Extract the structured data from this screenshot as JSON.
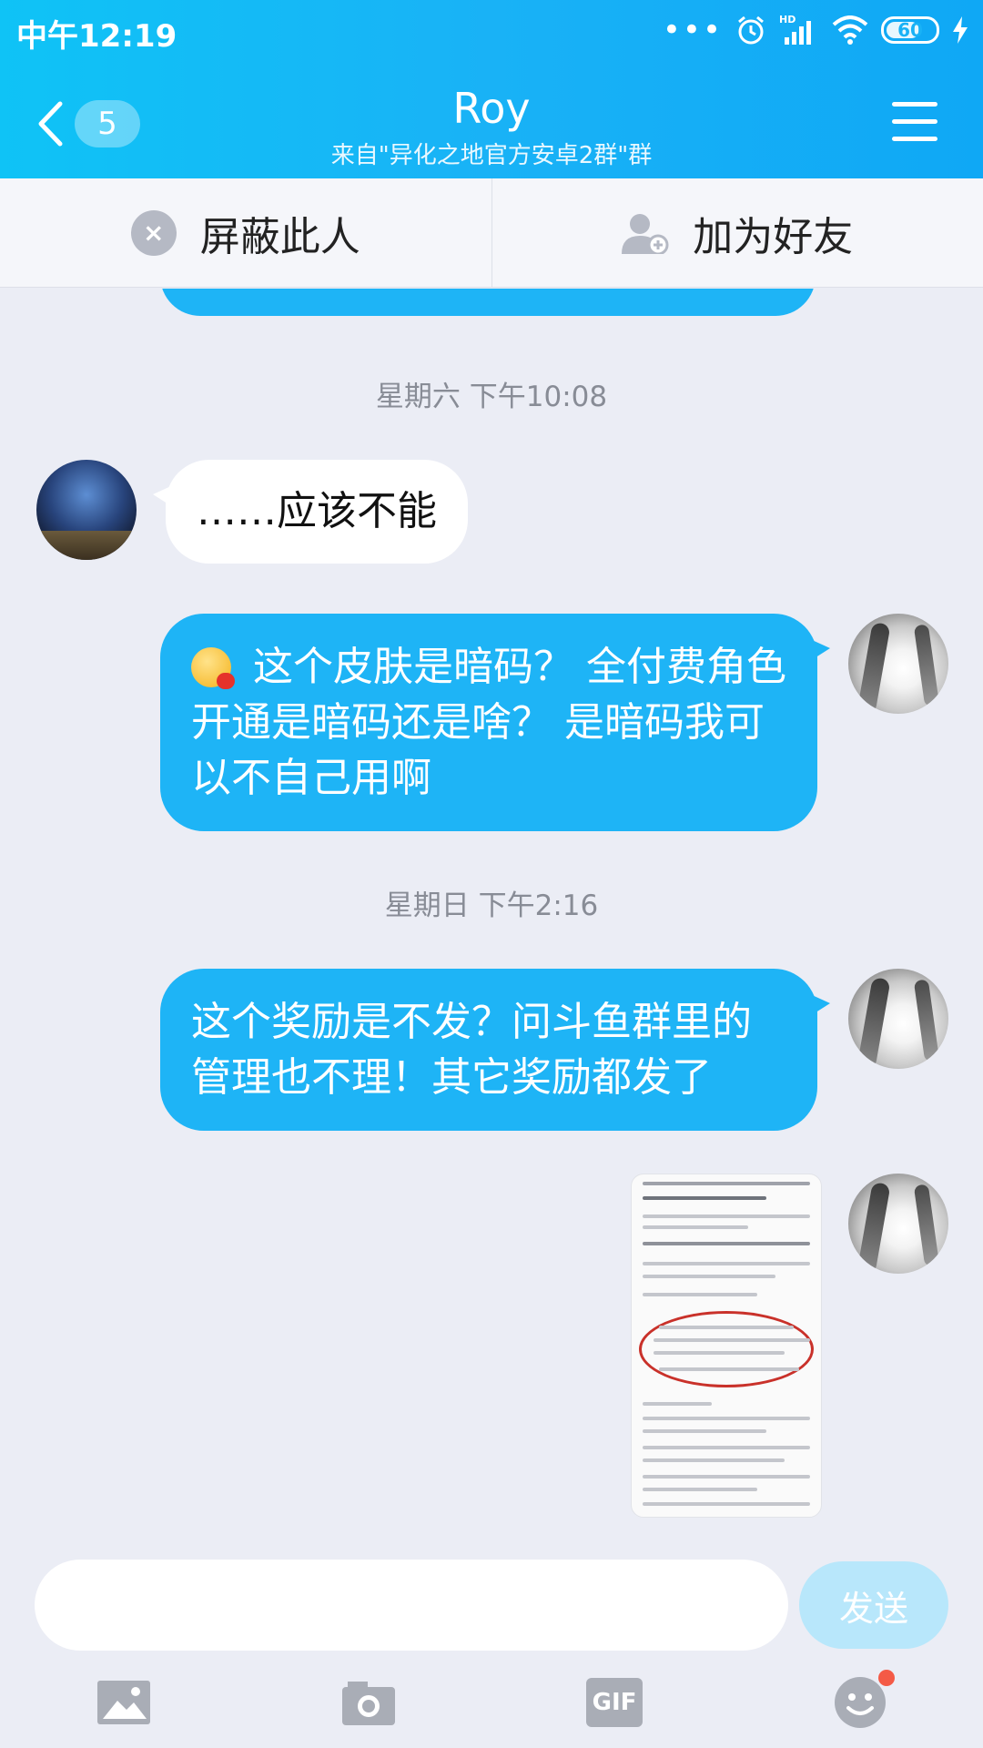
{
  "status_bar": {
    "time": "中午12:19",
    "network": "HD",
    "battery": "60"
  },
  "header": {
    "back_count": "5",
    "title": "Roy",
    "subtitle": "来自\"异化之地官方安卓2群\"群"
  },
  "actions": {
    "block_label": "屏蔽此人",
    "add_friend_label": "加为好友"
  },
  "messages": [
    {
      "type": "timestamp",
      "text": "星期六 下午10:08"
    },
    {
      "type": "incoming",
      "text": "……应该不能"
    },
    {
      "type": "outgoing",
      "emoji": "vomiting-face",
      "text": "这个皮肤是暗码？ 全付费角色开通是暗码还是啥？ 是暗码我可以不自己用啊"
    },
    {
      "type": "timestamp",
      "text": "星期日 下午2:16"
    },
    {
      "type": "outgoing",
      "text": "这个奖励是不发？问斗鱼群里的管理也不理！其它奖励都发了"
    },
    {
      "type": "outgoing-image",
      "alt": "screenshot-thumbnail"
    }
  ],
  "input": {
    "value": "",
    "send_label": "发送"
  },
  "toolbar": {
    "gif_label": "GIF"
  },
  "colors": {
    "header_gradient_start": "#0fc3f6",
    "header_gradient_end": "#0fa8f5",
    "outgoing_bubble": "#1eb4f6",
    "incoming_bubble": "#ffffff",
    "chat_background": "#ebedf5",
    "send_button_disabled": "#b8e7fb"
  }
}
